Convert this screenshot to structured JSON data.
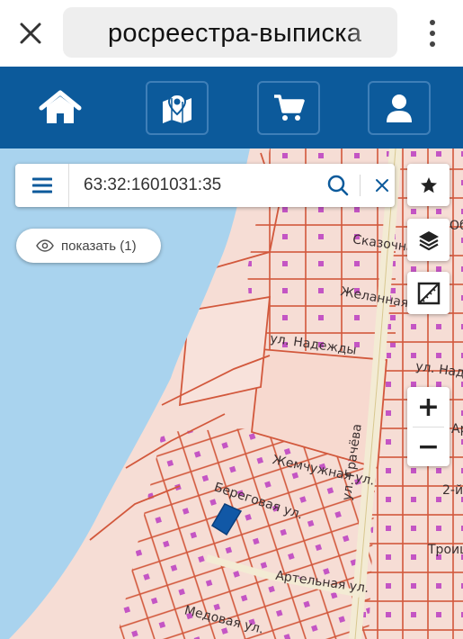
{
  "browser": {
    "url_text": "росреестра-выписка",
    "close_icon": "close-icon",
    "menu_icon": "more-vert-icon"
  },
  "nav": {
    "items": [
      {
        "icon": "home-icon"
      },
      {
        "icon": "map-pin-icon"
      },
      {
        "icon": "cart-icon"
      },
      {
        "icon": "user-icon"
      }
    ],
    "color": "#0c5a9b"
  },
  "search": {
    "value": "63:32:1601031:35",
    "menu_icon": "hamburger-icon",
    "search_icon": "search-icon",
    "clear_icon": "close-icon"
  },
  "show_button": {
    "label": "показать (1)",
    "icon": "eye-icon"
  },
  "map_controls": {
    "favorite_icon": "star-icon",
    "layers_icon": "layers-icon",
    "ruler_icon": "ruler-icon",
    "zoom_in": "+",
    "zoom_out": "−"
  },
  "streets": {
    "skazochnaya": "Сказочна",
    "zhelannaya": "Желанная ул.",
    "nadezhdy": "ул. Надежды",
    "nadezhdy_east": "ул. Над",
    "zhemchuzhnaya": "Жемчужная ул.",
    "beregovaya": "Береговая ул.",
    "gracheva": "ул. Грачёва",
    "artelnaya": "Артельная ул.",
    "medovaya": "Медовая ул.",
    "troits": "Троиц",
    "vtoraya": "2-й",
    "ob": "Об",
    "ar": "Ар"
  },
  "colors": {
    "water": "#a9d3ee",
    "land": "#f6ddd5",
    "parcel_border": "#d2583c",
    "selected_parcel": "#1158a6",
    "building": "#c455c4",
    "road": "#f3ebd4"
  }
}
